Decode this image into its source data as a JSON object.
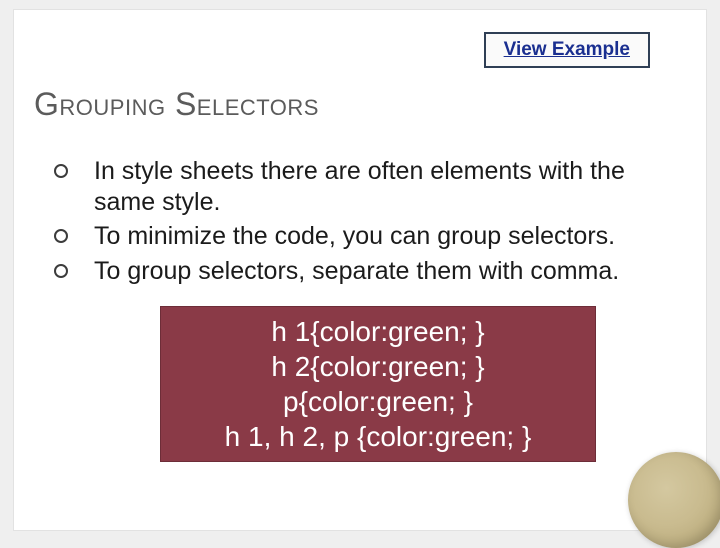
{
  "link": {
    "label": "View Example"
  },
  "title": "Grouping Selectors",
  "bullets": [
    "In style sheets there are often elements with the same style.",
    "To minimize the code, you can group selectors.",
    "To group selectors, separate them with comma."
  ],
  "code": {
    "lines": [
      "h 1{color:green; }",
      "h 2{color:green; }",
      "p{color:green; }",
      "h 1, h 2, p {color:green; }"
    ]
  }
}
